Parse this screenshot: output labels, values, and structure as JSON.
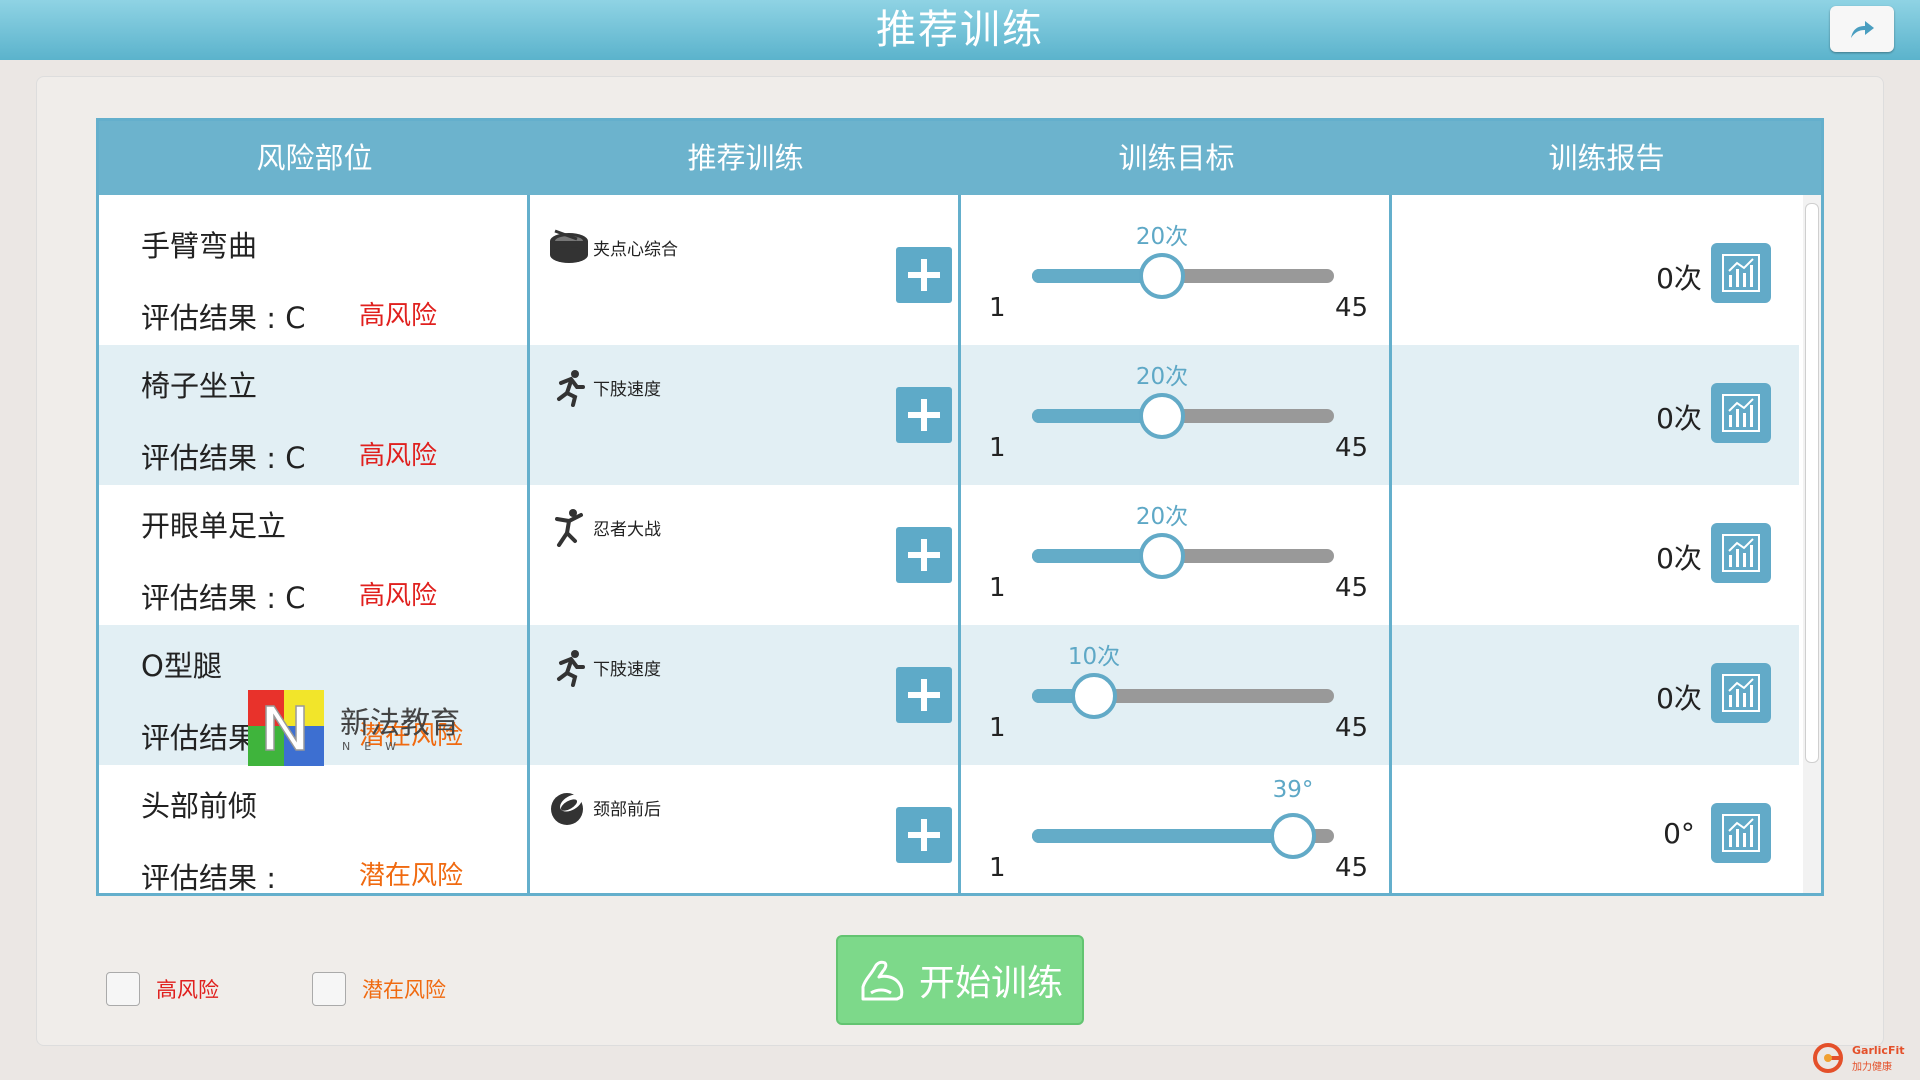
{
  "header": {
    "title": "推荐训练",
    "share_icon": "share-arrow-icon"
  },
  "table": {
    "columns": [
      "风险部位",
      "推荐训练",
      "训练目标",
      "训练报告"
    ],
    "rows": [
      {
        "part": "手臂弯曲",
        "eval": "评估结果 : C",
        "risk": "高风险",
        "risk_type": "high",
        "training": "夹点心综合",
        "icon": "drum-icon",
        "target_label": "20次",
        "target_value": 20,
        "min": "1",
        "max": "45",
        "report": "0次"
      },
      {
        "part": "椅子坐立",
        "eval": "评估结果 : C",
        "risk": "高风险",
        "risk_type": "high",
        "training": "下肢速度",
        "icon": "runner-icon",
        "target_label": "20次",
        "target_value": 20,
        "min": "1",
        "max": "45",
        "report": "0次"
      },
      {
        "part": "开眼单足立",
        "eval": "评估结果 : C",
        "risk": "高风险",
        "risk_type": "high",
        "training": "忍者大战",
        "icon": "ninja-icon",
        "target_label": "20次",
        "target_value": 20,
        "min": "1",
        "max": "45",
        "report": "0次"
      },
      {
        "part": "O型腿",
        "eval": "评估结果 :",
        "risk": "潜在风险",
        "risk_type": "latent",
        "training": "下肢速度",
        "icon": "runner-icon",
        "target_label": "10次",
        "target_value": 10,
        "min": "1",
        "max": "45",
        "report": "0次"
      },
      {
        "part": "头部前倾",
        "eval": "评估结果 :",
        "risk": "潜在风险",
        "risk_type": "latent",
        "training": "颈部前后",
        "icon": "neck-icon",
        "target_label": "39°",
        "target_value": 39,
        "min": "1",
        "max": "45",
        "report": "0°"
      }
    ]
  },
  "legend": {
    "high": "高风险",
    "latent": "潜在风险"
  },
  "start_button": {
    "label": "开始训练"
  },
  "watermark": {
    "text": "新法教育",
    "sub": "NEW"
  },
  "brand": {
    "name": "GarlicFit",
    "sub": "加力健康"
  },
  "colors": {
    "header": "#6cb3cd",
    "accent": "#62aac8",
    "high_risk": "#e0201e",
    "latent_risk": "#f06a10",
    "start": "#7dd98a"
  }
}
